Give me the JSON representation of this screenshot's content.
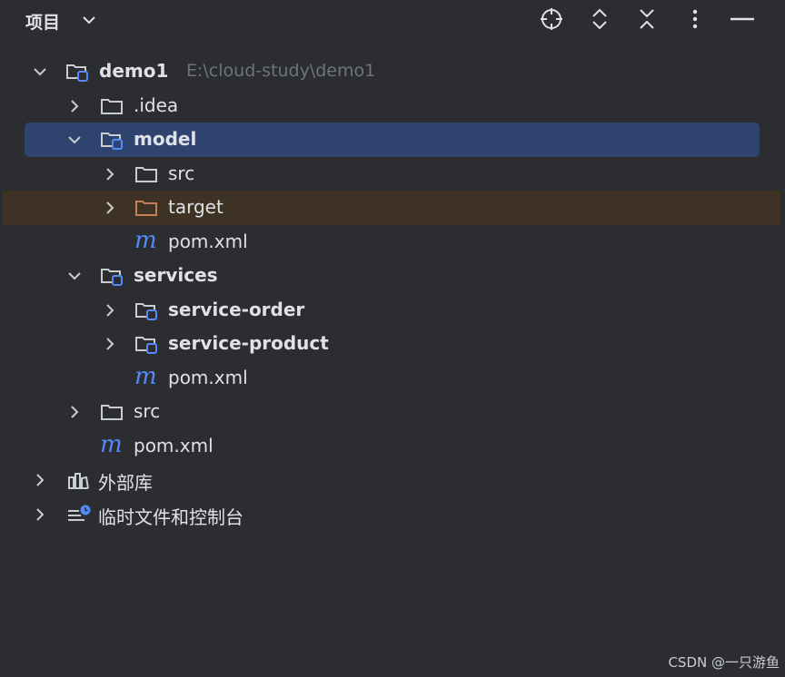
{
  "panel": {
    "title": "项目"
  },
  "toolbar": {
    "items": [
      {
        "name": "locate-icon"
      },
      {
        "name": "expand-all-icon"
      },
      {
        "name": "collapse-all-icon"
      },
      {
        "name": "more-options-icon"
      },
      {
        "name": "minimize-icon"
      }
    ]
  },
  "tree": {
    "root": {
      "label": "demo1",
      "path": "E:\\cloud-study\\demo1"
    },
    "idea": "idea_placeholder",
    "labels": {
      "idea": ".idea",
      "model": "model",
      "model_src": "src",
      "model_target": "target",
      "model_pom": "pom.xml",
      "services": "services",
      "service_order": "service-order",
      "service_product": "service-product",
      "services_pom": "pom.xml",
      "src": "src",
      "root_pom": "pom.xml",
      "external_libs": "外部库",
      "scratches": "临时文件和控制台"
    },
    "maven_glyph": "m"
  },
  "watermark": "CSDN @一只游鱼",
  "colors": {
    "background": "#2b2d30",
    "selection": "#2e436e",
    "excluded": "#3d3223",
    "module_badge": "#548af7",
    "target_folder": "#c77d55"
  }
}
